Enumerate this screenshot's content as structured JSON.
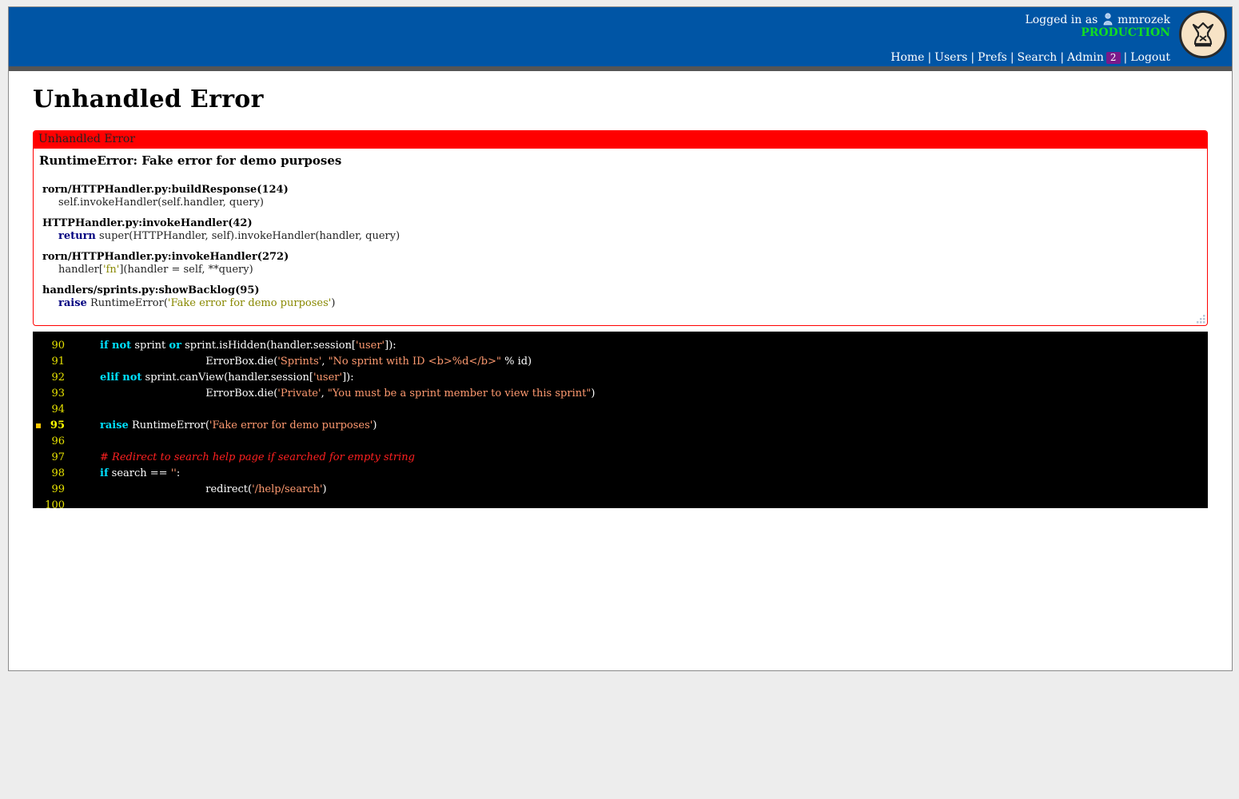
{
  "header": {
    "logged_in_prefix": "Logged in as",
    "username": "mmrozek",
    "environment": "PRODUCTION",
    "nav": [
      {
        "label": "Home"
      },
      {
        "label": "Users"
      },
      {
        "label": "Prefs"
      },
      {
        "label": "Search"
      },
      {
        "label": "Admin",
        "badge": "2"
      },
      {
        "label": "Logout"
      }
    ],
    "colors": {
      "bar": "#0055a5",
      "environment": "#11dd22",
      "badge": "#7a1a8a"
    }
  },
  "page": {
    "title": "Unhandled Error"
  },
  "error_box": {
    "header": "Unhandled Error",
    "message": "RuntimeError: Fake error for demo purposes",
    "frames": [
      {
        "location": "rorn/HTTPHandler.py:buildResponse(124)",
        "code": "self.invokeHandler(self.handler, query)"
      },
      {
        "location": "HTTPHandler.py:invokeHandler(42)",
        "keyword": "return",
        "code": " super(HTTPHandler, self).invokeHandler(handler, query)"
      },
      {
        "location": "rorn/HTTPHandler.py:invokeHandler(272)",
        "code_before": "handler[",
        "string": "'fn'",
        "code_after": "](handler = self, **query)"
      },
      {
        "location": "handlers/sprints.py:showBacklog(95)",
        "keyword": "raise",
        "code_before": " RuntimeError(",
        "string": "'Fake error for demo purposes'",
        "code_after": ")"
      }
    ]
  },
  "source": {
    "current_line": 95,
    "line_numbers": [
      "90",
      "91",
      "92",
      "93",
      "94",
      "95",
      "96",
      "97",
      "98",
      "99",
      "100"
    ],
    "lines": [
      {
        "indent": "",
        "k1": "if not",
        "t1": " sprint ",
        "k2": "or",
        "t2": " sprint.isHidden(handler.session[",
        "s1": "'user'",
        "t3": "]):"
      },
      {
        "indent": "    ",
        "t1": "ErrorBox.die(",
        "s1": "'Sprints'",
        "t2": ", ",
        "s2": "\"No sprint with ID <b>%d</b>\"",
        "t3": " % id)"
      },
      {
        "indent": "",
        "k1": "elif not",
        "t1": " sprint.canView(handler.session[",
        "s1": "'user'",
        "t2": "]):"
      },
      {
        "indent": "    ",
        "t1": "ErrorBox.die(",
        "s1": "'Private'",
        "t2": ", ",
        "s2": "\"You must be a sprint member to view this sprint\"",
        "t3": ")"
      },
      {},
      {
        "indent": "",
        "k1": "raise",
        "t1": " RuntimeError(",
        "s1": "'Fake error for demo purposes'",
        "t2": ")"
      },
      {},
      {
        "indent": "",
        "comment": "# Redirect to search help page if searched for empty string"
      },
      {
        "indent": "",
        "k1": "if",
        "t1": " search == ",
        "s1": "''",
        "t2": ":"
      },
      {
        "indent": "    ",
        "t1": "redirect(",
        "s1": "'/help/search'",
        "t2": ")"
      },
      {}
    ],
    "colors": {
      "background": "#000000",
      "keyword": "#00e0ff",
      "string": "#ff9a70",
      "comment": "#ff2020",
      "line_number": "#e6e200",
      "marker": "#ffc600"
    }
  }
}
